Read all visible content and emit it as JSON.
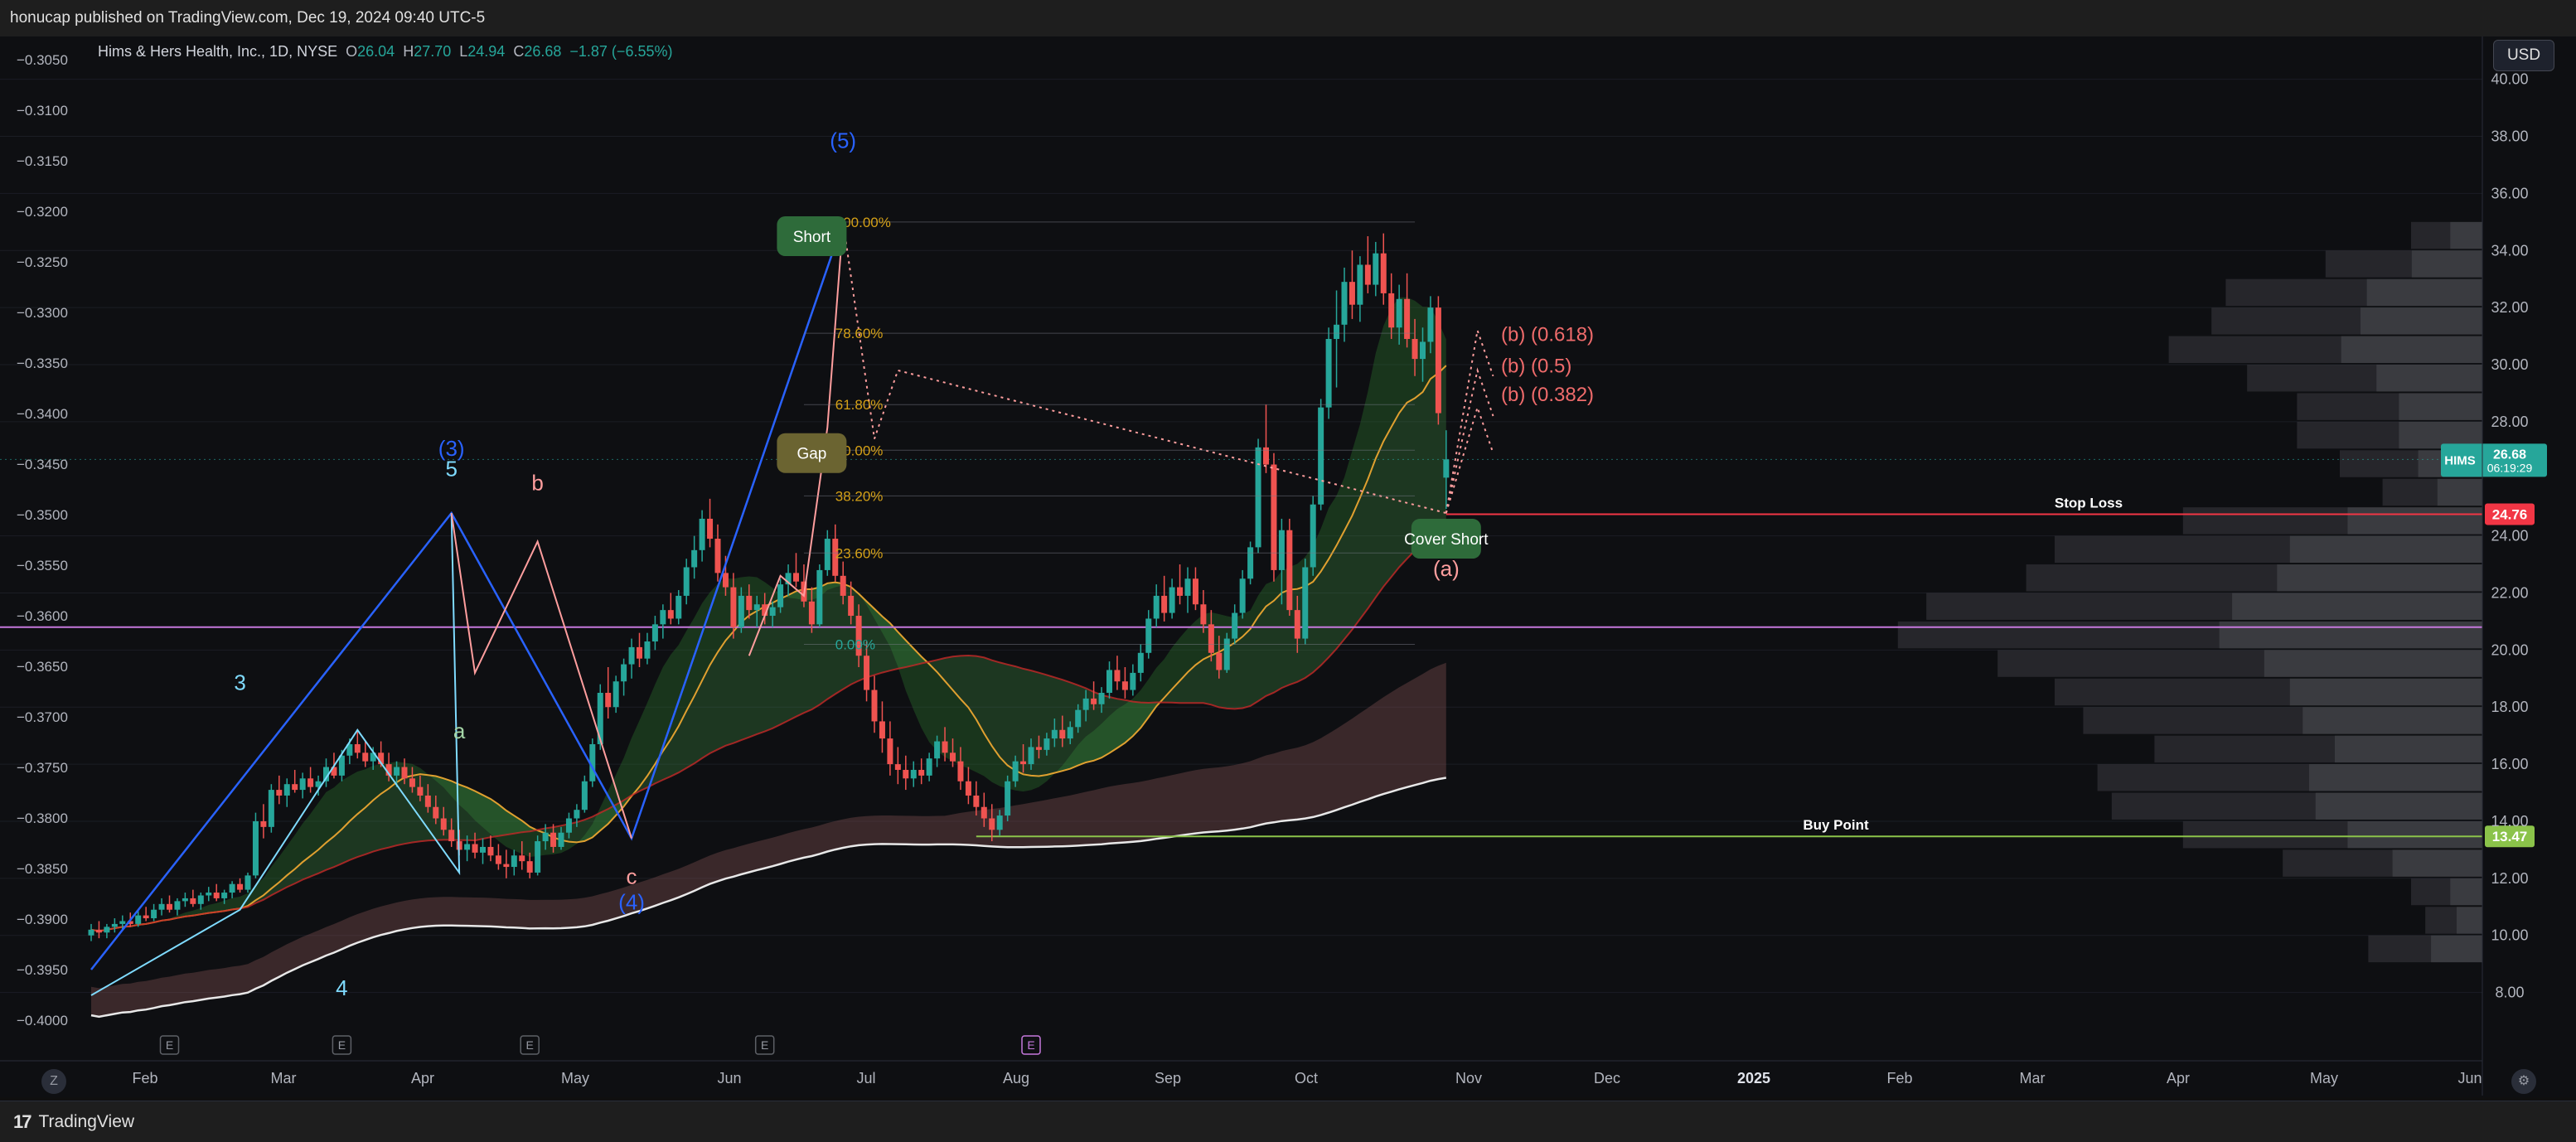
{
  "header": {
    "published": "honucap published on TradingView.com, Dec 19, 2024 09:40 UTC-5"
  },
  "legend": {
    "symbol": "Hims & Hers Health, Inc., 1D, NYSE",
    "o_label": "O",
    "o_value": "26.04",
    "h_label": "H",
    "h_value": "27.70",
    "l_label": "L",
    "l_value": "24.94",
    "c_label": "C",
    "c_value": "26.68",
    "change": "−1.87 (−6.55%)"
  },
  "currency_button": "USD",
  "footer": {
    "brand": "TradingView",
    "logo_glyph": "17",
    "z_button": "Z"
  },
  "colors": {
    "up": "#26a69a",
    "down": "#ef5350",
    "wave_blue": "#2962ff",
    "wave_cyan": "#7fdbff",
    "wave_pink": "#ff9e9e",
    "stop_loss": "#f23645",
    "buy_point": "#8bc34a",
    "magenta_line": "#c678dd"
  },
  "chart_data": {
    "type": "candlestick",
    "symbol": "HIMS",
    "title": "Hims & Hers Health, Inc., 1D, NYSE",
    "right_axis": {
      "ticks": [
        "40.00",
        "38.00",
        "36.00",
        "34.00",
        "32.00",
        "30.00",
        "28.00",
        "24.00",
        "22.00",
        "20.00",
        "18.00",
        "16.00",
        "14.00",
        "12.00",
        "10.00",
        "8.00"
      ],
      "range": [
        7.0,
        41.5
      ]
    },
    "left_axis": {
      "ticks": [
        "−0.3050",
        "−0.3100",
        "−0.3150",
        "−0.3200",
        "−0.3250",
        "−0.3300",
        "−0.3350",
        "−0.3400",
        "−0.3450",
        "−0.3500",
        "−0.3550",
        "−0.3600",
        "−0.3650",
        "−0.3700",
        "−0.3750",
        "−0.3800",
        "−0.3850",
        "−0.3900",
        "−0.3950",
        "−0.4000"
      ]
    },
    "x_axis_labels": [
      "Feb",
      "Mar",
      "Apr",
      "May",
      "Jun",
      "Jul",
      "Aug",
      "Sep",
      "Oct",
      "Nov",
      "Dec",
      "2025",
      "Feb",
      "Mar",
      "Apr",
      "May",
      "Jun"
    ],
    "last_price": {
      "symbol": "HIMS",
      "price": "26.68",
      "countdown": "06:19:29"
    },
    "price_levels": [
      {
        "name": "Stop Loss",
        "value": 24.76,
        "tag": "24.76"
      },
      {
        "name": "Buy Point",
        "value": 13.47,
        "tag": "13.47"
      }
    ],
    "wave_labels": [
      {
        "text": "(5)",
        "color": "#2962ff"
      },
      {
        "text": "(3)",
        "color": "#2962ff"
      },
      {
        "text": "5",
        "color": "#7fdbff"
      },
      {
        "text": "3",
        "color": "#7fdbff"
      },
      {
        "text": "4",
        "color": "#7fdbff"
      },
      {
        "text": "b",
        "color": "#ff9e9e"
      },
      {
        "text": "a",
        "color": "#a5d6a7"
      },
      {
        "text": "c",
        "color": "#ff9e9e"
      },
      {
        "text": "(4)",
        "color": "#2962ff"
      },
      {
        "text": "(a)",
        "color": "#ff9e9e"
      }
    ],
    "callouts": [
      "Short",
      "Gap",
      "Cover Short"
    ],
    "fib_levels": [
      "100.00%",
      "78.60%",
      "61.80%",
      "50.00%",
      "38.20%",
      "23.60%",
      "0.00%"
    ],
    "projections": [
      "(b) (0.618)",
      "(b) (0.5)",
      "(b) (0.382)"
    ],
    "event_markers": [
      "E",
      "E",
      "E",
      "E",
      "E"
    ],
    "candles": [
      [
        10.0,
        10.4,
        9.8,
        10.2
      ],
      [
        10.2,
        10.5,
        9.9,
        10.1
      ],
      [
        10.1,
        10.4,
        9.9,
        10.3
      ],
      [
        10.3,
        10.6,
        10.1,
        10.4
      ],
      [
        10.4,
        10.7,
        10.2,
        10.5
      ],
      [
        10.5,
        10.8,
        10.3,
        10.4
      ],
      [
        10.4,
        10.9,
        10.3,
        10.7
      ],
      [
        10.7,
        11.0,
        10.5,
        10.6
      ],
      [
        10.6,
        11.1,
        10.5,
        10.9
      ],
      [
        10.9,
        11.3,
        10.7,
        11.1
      ],
      [
        11.1,
        11.4,
        10.8,
        10.9
      ],
      [
        10.9,
        11.3,
        10.7,
        11.2
      ],
      [
        11.2,
        11.5,
        11.0,
        11.3
      ],
      [
        11.3,
        11.6,
        11.0,
        11.1
      ],
      [
        11.1,
        11.5,
        10.9,
        11.4
      ],
      [
        11.4,
        11.7,
        11.2,
        11.5
      ],
      [
        11.5,
        11.8,
        11.2,
        11.3
      ],
      [
        11.3,
        11.6,
        11.1,
        11.5
      ],
      [
        11.5,
        11.9,
        11.3,
        11.8
      ],
      [
        11.8,
        12.0,
        11.5,
        11.6
      ],
      [
        11.6,
        12.2,
        11.5,
        12.1
      ],
      [
        12.1,
        14.3,
        12.0,
        14.0
      ],
      [
        14.0,
        14.6,
        13.4,
        13.8
      ],
      [
        13.8,
        15.3,
        13.6,
        15.1
      ],
      [
        15.1,
        15.6,
        14.6,
        14.9
      ],
      [
        14.9,
        15.5,
        14.5,
        15.3
      ],
      [
        15.3,
        15.8,
        15.0,
        15.1
      ],
      [
        15.1,
        15.7,
        14.8,
        15.5
      ],
      [
        15.5,
        15.9,
        15.0,
        15.2
      ],
      [
        15.2,
        15.6,
        14.9,
        15.4
      ],
      [
        15.4,
        16.2,
        15.2,
        15.9
      ],
      [
        15.9,
        16.4,
        15.5,
        15.6
      ],
      [
        15.6,
        16.5,
        15.4,
        16.3
      ],
      [
        16.3,
        16.9,
        16.0,
        16.7
      ],
      [
        16.7,
        17.2,
        16.2,
        16.4
      ],
      [
        16.4,
        16.8,
        15.9,
        16.1
      ],
      [
        16.1,
        16.6,
        15.8,
        16.4
      ],
      [
        16.4,
        16.8,
        15.9,
        16.0
      ],
      [
        16.0,
        16.4,
        15.4,
        15.6
      ],
      [
        15.6,
        16.1,
        15.2,
        15.9
      ],
      [
        15.9,
        16.2,
        15.3,
        15.5
      ],
      [
        15.5,
        15.9,
        15.0,
        15.2
      ],
      [
        15.2,
        15.6,
        14.7,
        14.9
      ],
      [
        14.9,
        15.3,
        14.3,
        14.5
      ],
      [
        14.5,
        14.9,
        13.9,
        14.1
      ],
      [
        14.1,
        14.5,
        13.5,
        13.7
      ],
      [
        13.7,
        14.1,
        13.1,
        13.3
      ],
      [
        13.3,
        13.7,
        12.8,
        13.0
      ],
      [
        13.0,
        13.5,
        12.6,
        13.2
      ],
      [
        13.2,
        13.6,
        12.7,
        12.9
      ],
      [
        12.9,
        13.4,
        12.5,
        13.1
      ],
      [
        13.1,
        13.5,
        12.6,
        12.8
      ],
      [
        12.8,
        13.2,
        12.3,
        12.5
      ],
      [
        12.5,
        13.0,
        12.0,
        12.4
      ],
      [
        12.4,
        13.0,
        12.1,
        12.8
      ],
      [
        12.8,
        13.3,
        12.3,
        12.6
      ],
      [
        12.6,
        12.9,
        12.0,
        12.2
      ],
      [
        12.2,
        13.5,
        12.1,
        13.3
      ],
      [
        13.3,
        13.9,
        13.0,
        13.6
      ],
      [
        13.6,
        13.9,
        12.9,
        13.1
      ],
      [
        13.1,
        13.8,
        13.0,
        13.6
      ],
      [
        13.6,
        14.3,
        13.4,
        14.1
      ],
      [
        14.1,
        14.6,
        13.8,
        14.4
      ],
      [
        14.4,
        15.6,
        14.3,
        15.4
      ],
      [
        15.4,
        16.9,
        15.2,
        16.7
      ],
      [
        16.7,
        18.8,
        16.5,
        18.5
      ],
      [
        18.5,
        19.4,
        17.6,
        18.0
      ],
      [
        18.0,
        19.1,
        17.8,
        18.9
      ],
      [
        18.9,
        19.7,
        18.4,
        19.5
      ],
      [
        19.5,
        20.4,
        19.0,
        20.1
      ],
      [
        20.1,
        20.6,
        19.4,
        19.7
      ],
      [
        19.7,
        20.6,
        19.5,
        20.3
      ],
      [
        20.3,
        21.2,
        20.0,
        20.9
      ],
      [
        20.9,
        21.6,
        20.4,
        21.4
      ],
      [
        21.4,
        22.0,
        20.9,
        21.1
      ],
      [
        21.1,
        22.1,
        20.9,
        21.9
      ],
      [
        21.9,
        23.2,
        21.6,
        22.9
      ],
      [
        22.9,
        24.0,
        22.5,
        23.5
      ],
      [
        23.5,
        24.9,
        23.1,
        24.6
      ],
      [
        24.6,
        25.3,
        23.6,
        23.9
      ],
      [
        23.9,
        24.4,
        22.4,
        22.7
      ],
      [
        22.7,
        23.3,
        21.9,
        22.2
      ],
      [
        22.2,
        22.7,
        20.4,
        20.8
      ],
      [
        20.8,
        22.2,
        20.6,
        21.9
      ],
      [
        21.9,
        22.3,
        21.1,
        21.4
      ],
      [
        21.4,
        21.9,
        20.8,
        21.6
      ],
      [
        21.6,
        22.0,
        20.9,
        21.2
      ],
      [
        21.2,
        21.7,
        20.8,
        21.5
      ],
      [
        21.5,
        22.5,
        21.3,
        22.3
      ],
      [
        22.3,
        23.0,
        21.9,
        22.7
      ],
      [
        22.7,
        23.4,
        22.2,
        22.4
      ],
      [
        22.4,
        23.0,
        21.5,
        21.7
      ],
      [
        21.7,
        22.2,
        20.6,
        20.9
      ],
      [
        20.9,
        23.0,
        20.8,
        22.8
      ],
      [
        22.8,
        24.2,
        22.6,
        23.9
      ],
      [
        23.9,
        24.4,
        22.4,
        22.6
      ],
      [
        22.6,
        23.1,
        21.6,
        21.9
      ],
      [
        21.9,
        22.4,
        20.9,
        21.2
      ],
      [
        21.2,
        21.6,
        19.4,
        19.8
      ],
      [
        19.8,
        20.3,
        18.2,
        18.6
      ],
      [
        18.6,
        19.1,
        17.1,
        17.5
      ],
      [
        17.5,
        18.2,
        16.4,
        16.9
      ],
      [
        16.9,
        17.5,
        15.6,
        16.0
      ],
      [
        16.0,
        16.6,
        15.3,
        15.8
      ],
      [
        15.8,
        16.3,
        15.1,
        15.5
      ],
      [
        15.5,
        16.1,
        15.2,
        15.8
      ],
      [
        15.8,
        16.2,
        15.3,
        15.6
      ],
      [
        15.6,
        16.4,
        15.4,
        16.2
      ],
      [
        16.2,
        17.0,
        15.9,
        16.8
      ],
      [
        16.8,
        17.3,
        16.1,
        16.4
      ],
      [
        16.4,
        16.9,
        15.9,
        16.1
      ],
      [
        16.1,
        16.6,
        15.1,
        15.4
      ],
      [
        15.4,
        15.9,
        14.6,
        14.9
      ],
      [
        14.9,
        15.4,
        14.2,
        14.5
      ],
      [
        14.5,
        15.0,
        13.8,
        14.1
      ],
      [
        14.1,
        14.6,
        13.3,
        13.7
      ],
      [
        13.7,
        14.4,
        13.5,
        14.2
      ],
      [
        14.2,
        15.6,
        14.0,
        15.4
      ],
      [
        15.4,
        16.3,
        15.2,
        16.1
      ],
      [
        16.1,
        16.7,
        15.7,
        16.0
      ],
      [
        16.0,
        16.9,
        15.8,
        16.6
      ],
      [
        16.6,
        17.0,
        16.2,
        16.5
      ],
      [
        16.5,
        17.1,
        16.3,
        16.9
      ],
      [
        16.9,
        17.6,
        16.6,
        17.2
      ],
      [
        17.2,
        17.7,
        16.6,
        16.9
      ],
      [
        16.9,
        17.5,
        16.7,
        17.3
      ],
      [
        17.3,
        18.1,
        17.1,
        17.9
      ],
      [
        17.9,
        18.6,
        17.5,
        18.3
      ],
      [
        18.3,
        18.9,
        17.9,
        18.1
      ],
      [
        18.1,
        18.7,
        17.8,
        18.5
      ],
      [
        18.5,
        19.6,
        18.3,
        19.3
      ],
      [
        19.3,
        19.8,
        18.6,
        18.9
      ],
      [
        18.9,
        19.4,
        18.3,
        18.6
      ],
      [
        18.6,
        19.5,
        18.4,
        19.2
      ],
      [
        19.2,
        20.2,
        18.9,
        19.9
      ],
      [
        19.9,
        21.4,
        19.7,
        21.1
      ],
      [
        21.1,
        22.3,
        20.8,
        21.9
      ],
      [
        21.9,
        22.6,
        21.0,
        21.3
      ],
      [
        21.3,
        22.5,
        21.1,
        22.2
      ],
      [
        22.2,
        23.0,
        21.6,
        21.9
      ],
      [
        21.9,
        22.9,
        21.3,
        22.5
      ],
      [
        22.5,
        22.9,
        21.4,
        21.6
      ],
      [
        21.6,
        22.1,
        20.6,
        20.9
      ],
      [
        20.9,
        21.4,
        19.6,
        19.9
      ],
      [
        19.9,
        20.5,
        19.0,
        19.3
      ],
      [
        19.3,
        20.6,
        19.2,
        20.4
      ],
      [
        20.4,
        21.6,
        20.2,
        21.3
      ],
      [
        21.3,
        22.8,
        21.1,
        22.5
      ],
      [
        22.5,
        23.8,
        22.3,
        23.6
      ],
      [
        23.6,
        27.4,
        23.4,
        27.1
      ],
      [
        27.1,
        28.6,
        26.2,
        26.5
      ],
      [
        26.5,
        26.9,
        22.4,
        22.8
      ],
      [
        22.8,
        24.6,
        21.6,
        24.2
      ],
      [
        24.2,
        24.6,
        21.2,
        21.4
      ],
      [
        21.4,
        21.9,
        19.9,
        20.4
      ],
      [
        20.4,
        23.2,
        20.2,
        22.9
      ],
      [
        22.9,
        25.4,
        22.6,
        25.1
      ],
      [
        25.1,
        28.8,
        24.9,
        28.5
      ],
      [
        28.5,
        31.3,
        28.1,
        30.9
      ],
      [
        30.9,
        32.6,
        29.2,
        31.4
      ],
      [
        31.4,
        33.4,
        30.8,
        32.9
      ],
      [
        32.9,
        34.0,
        31.6,
        32.1
      ],
      [
        32.1,
        33.8,
        31.5,
        33.5
      ],
      [
        33.5,
        34.5,
        32.5,
        32.8
      ],
      [
        32.8,
        34.3,
        32.4,
        33.9
      ],
      [
        33.9,
        34.6,
        32.1,
        32.5
      ],
      [
        32.5,
        33.2,
        30.9,
        31.3
      ],
      [
        31.3,
        32.8,
        30.7,
        32.3
      ],
      [
        32.3,
        33.2,
        30.6,
        30.9
      ],
      [
        30.9,
        31.6,
        29.6,
        30.2
      ],
      [
        30.2,
        31.3,
        29.4,
        30.8
      ],
      [
        30.8,
        32.4,
        30.4,
        32.0
      ],
      [
        32.0,
        32.4,
        27.9,
        28.3
      ],
      [
        26.04,
        27.7,
        24.94,
        26.68
      ]
    ],
    "volume_profile_rows": [
      {
        "price": 34.5,
        "w": 0.1
      },
      {
        "price": 33.5,
        "w": 0.22
      },
      {
        "price": 32.5,
        "w": 0.36
      },
      {
        "price": 31.5,
        "w": 0.38
      },
      {
        "price": 30.5,
        "w": 0.44
      },
      {
        "price": 29.5,
        "w": 0.33
      },
      {
        "price": 28.5,
        "w": 0.26
      },
      {
        "price": 27.5,
        "w": 0.26
      },
      {
        "price": 26.5,
        "w": 0.2
      },
      {
        "price": 25.5,
        "w": 0.14
      },
      {
        "price": 24.5,
        "w": 0.42
      },
      {
        "price": 23.5,
        "w": 0.6
      },
      {
        "price": 22.5,
        "w": 0.64
      },
      {
        "price": 21.5,
        "w": 0.78
      },
      {
        "price": 20.5,
        "w": 0.82
      },
      {
        "price": 19.5,
        "w": 0.68
      },
      {
        "price": 18.5,
        "w": 0.6
      },
      {
        "price": 17.5,
        "w": 0.56
      },
      {
        "price": 16.5,
        "w": 0.46
      },
      {
        "price": 15.5,
        "w": 0.54
      },
      {
        "price": 14.5,
        "w": 0.52
      },
      {
        "price": 13.5,
        "w": 0.42
      },
      {
        "price": 12.5,
        "w": 0.28
      },
      {
        "price": 11.5,
        "w": 0.1
      },
      {
        "price": 10.5,
        "w": 0.08
      },
      {
        "price": 9.5,
        "w": 0.16
      }
    ]
  }
}
